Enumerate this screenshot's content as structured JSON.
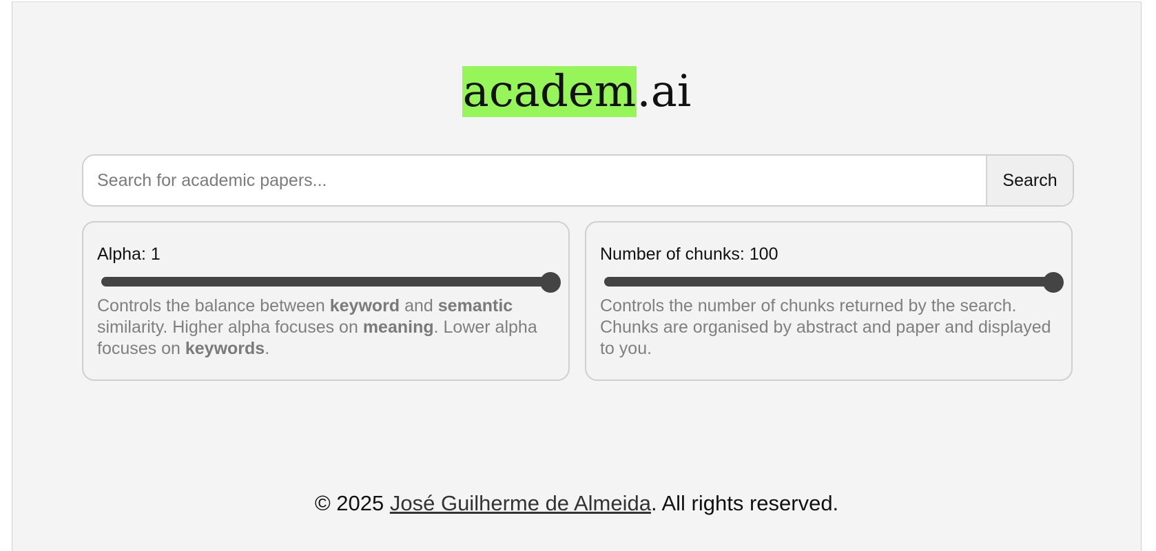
{
  "logo": {
    "highlight": "academ",
    "suffix": ".ai",
    "highlight_color": "#96f659"
  },
  "search": {
    "placeholder": "Search for academic papers...",
    "value": "",
    "button_label": "Search"
  },
  "alpha_card": {
    "label": "Alpha: 1",
    "slider_value": 1,
    "slider_min": 0,
    "slider_max": 1,
    "desc_parts": {
      "p1": "Controls the balance between ",
      "b1": "keyword",
      "p2": " and ",
      "b2": "semantic",
      "p3": " similarity. Higher alpha focuses on ",
      "b3": "meaning",
      "p4": ". Lower alpha focuses on ",
      "b4": "keywords",
      "p5": "."
    }
  },
  "chunks_card": {
    "label": "Number of chunks: 100",
    "slider_value": 100,
    "slider_min": 1,
    "slider_max": 100,
    "description": "Controls the number of chunks returned by the search. Chunks are organised by abstract and paper and displayed to you."
  },
  "footer": {
    "prefix": "© 2025 ",
    "author_link": "José Guilherme de Almeida",
    "suffix": ". All rights reserved."
  }
}
